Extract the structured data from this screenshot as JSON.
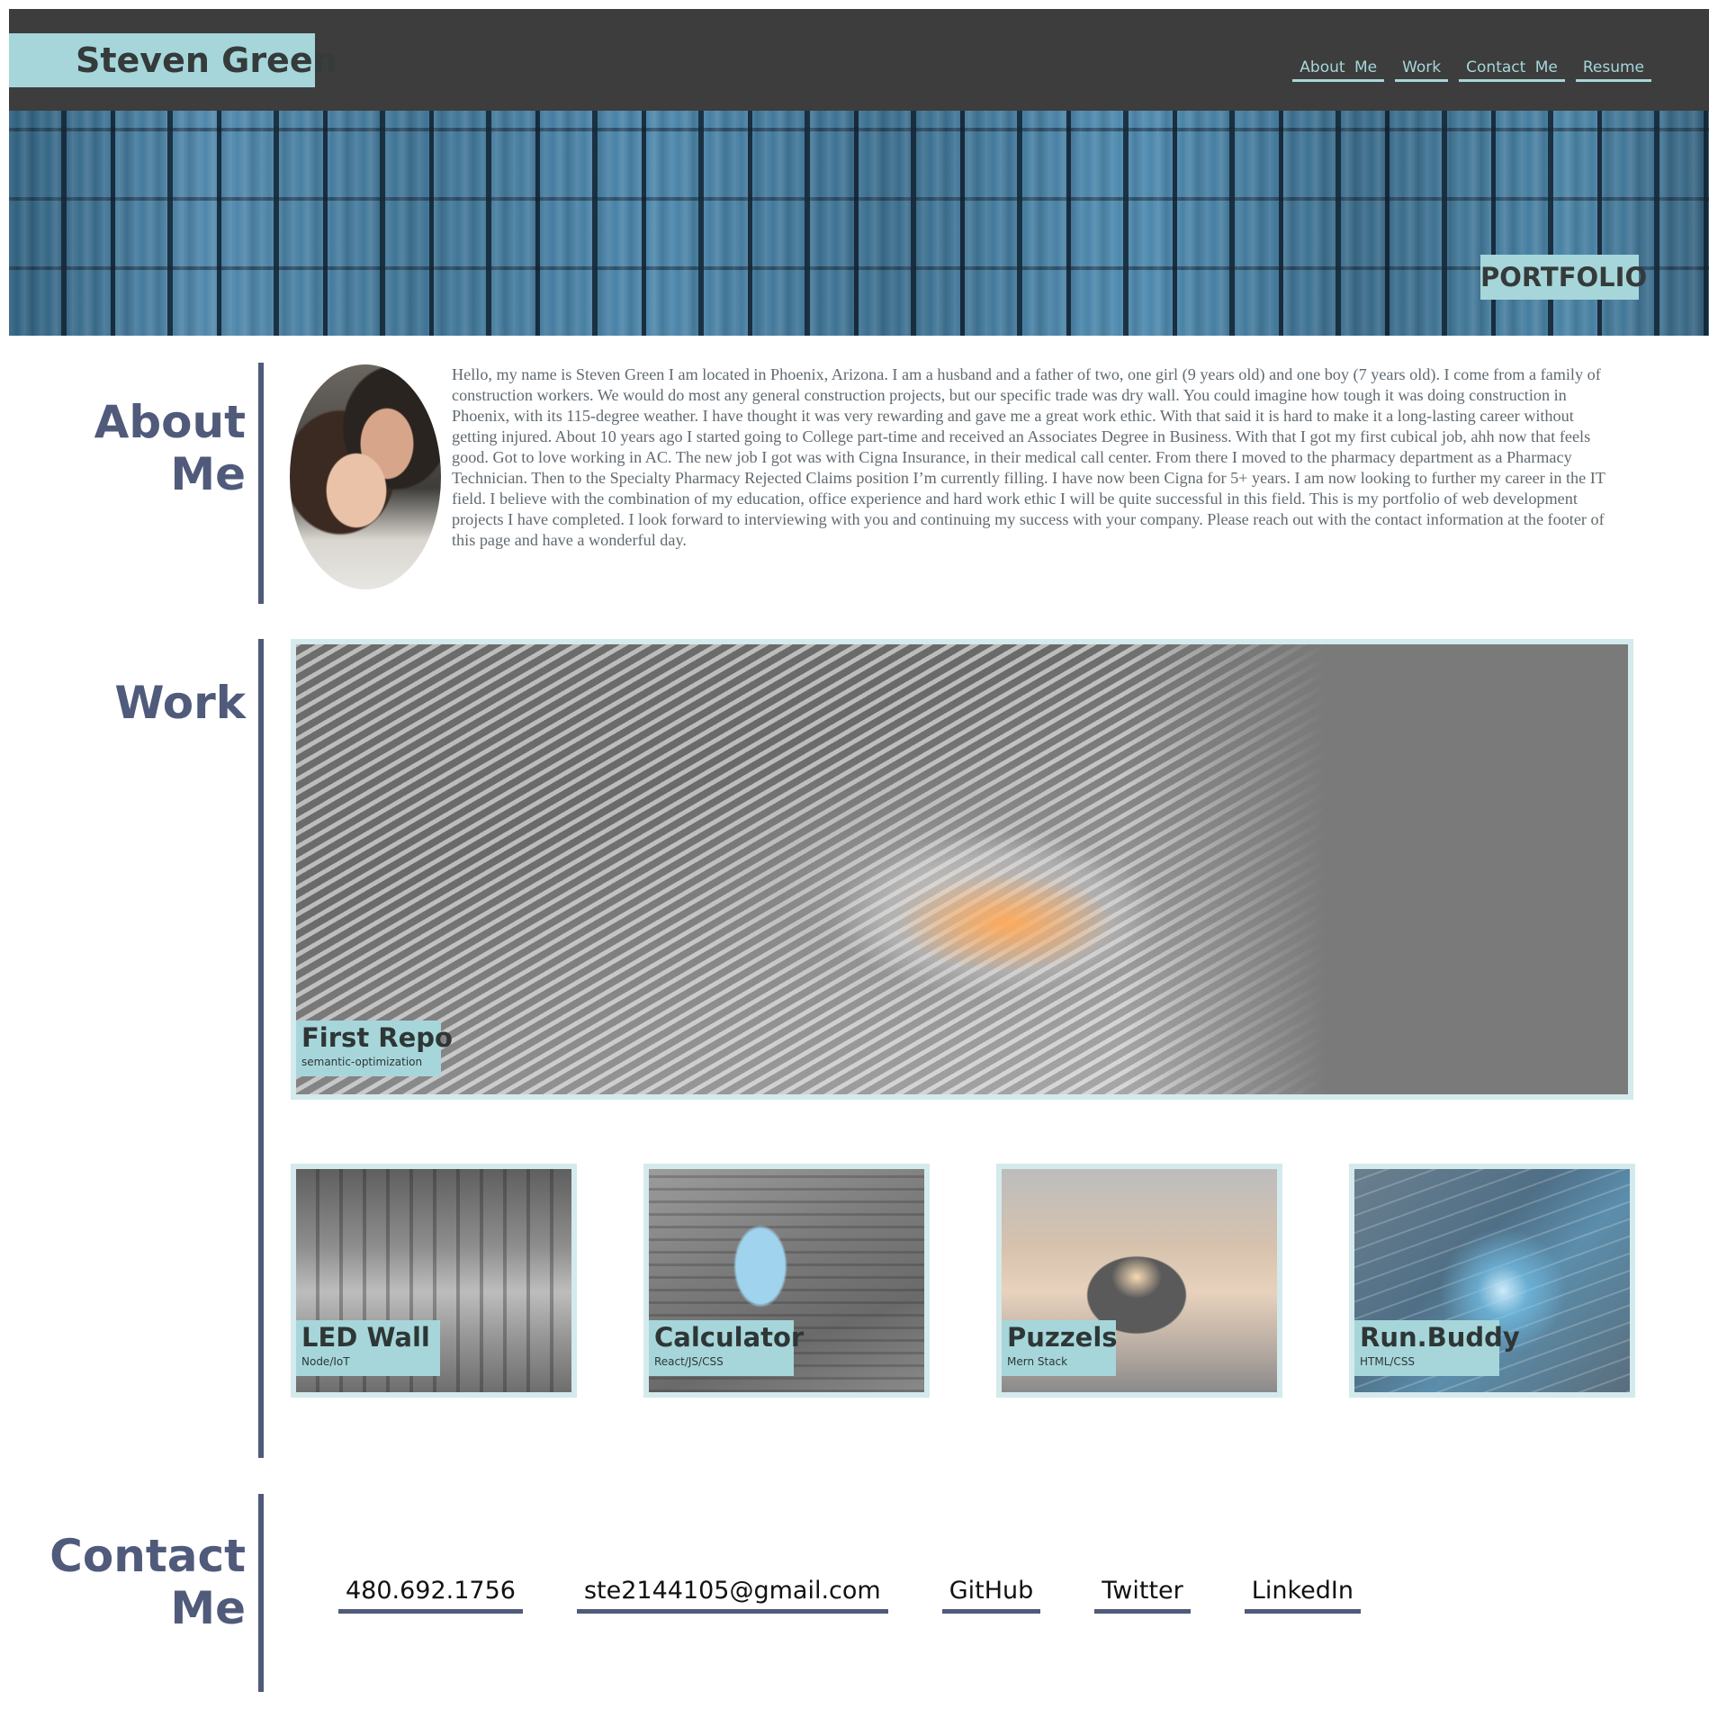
{
  "header": {
    "brand": "Steven Green",
    "nav": [
      "About  Me",
      "Work",
      "Contact  Me",
      "Resume"
    ]
  },
  "hero": {
    "tag": "PORTFOLIO"
  },
  "about": {
    "title_line1": "About",
    "title_line2": "Me",
    "bio": "Hello, my name is Steven Green I am located in Phoenix, Arizona. I am a husband and a father of two, one girl (9 years old) and one boy (7 years old). I come from a family of construction workers. We would do most any general construction projects, but our specific trade was dry wall. You could imagine how tough it was doing construction in Phoenix, with its 115-degree weather. I have thought it was very rewarding and gave me a great work ethic. With that said it is hard to make it a long-lasting career without getting injured. About 10 years ago I started going to College part-time and received an Associates Degree in Business. With that I got my first cubical job, ahh now that feels good. Got to love working in AC. The new job I got was with Cigna Insurance, in their medical call center. From there I moved to the pharmacy department as a Pharmacy Technician. Then to the Specialty Pharmacy Rejected Claims position I’m currently filling. I have now been Cigna for 5+ years. I am now looking to further my career in the IT field. I believe with the combination of my education, office experience and hard work ethic I will be quite successful in this field. This is my portfolio of web development projects I have completed. I look forward to interviewing with you and continuing my success with your company. Please reach out with the contact information at the footer of this page and have a wonderful day."
  },
  "work": {
    "title": "Work",
    "featured": {
      "title": "First Repo",
      "subtitle": "semantic-optimization"
    },
    "projects": [
      {
        "title": "LED Wall",
        "subtitle": "Node/IoT"
      },
      {
        "title": "Calculator",
        "subtitle": "React/JS/CSS"
      },
      {
        "title": "Puzzels",
        "subtitle": "Mern Stack"
      },
      {
        "title": "Run.Buddy",
        "subtitle": "HTML/CSS"
      }
    ]
  },
  "contact": {
    "title_line1": "Contact",
    "title_line2": "Me",
    "links": [
      "480.692.1756",
      "ste2144105@gmail.com",
      "GitHub",
      "Twitter",
      "LinkedIn"
    ]
  },
  "colors": {
    "header_bg": "#3d3d3d",
    "accent": "#a6d6da",
    "section_title": "#505a7a",
    "card_border": "#d4eaec"
  }
}
